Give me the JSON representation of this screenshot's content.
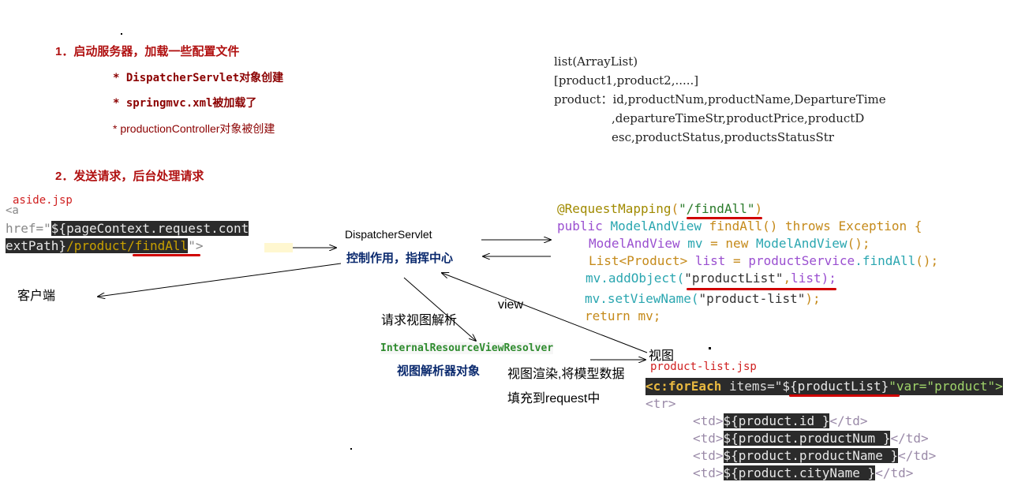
{
  "steps": {
    "step1": "1．启动服务器，加载一些配置文件",
    "step1_items": [
      "* DispatcherServlet对象创建",
      "* springmvc.xml被加载了",
      "* productionController对象被创建"
    ],
    "step2": "2．发送请求，后台处理请求"
  },
  "model_info": {
    "line1": "list(ArrayList)",
    "line2": "[product1,product2,.....]",
    "line3_label": "product：",
    "line3": "id,productNum,productName,DepartureTime",
    "line4": ",departureTimeStr,productPrice,productD",
    "line5": "esc,productStatus,productsStatusStr"
  },
  "aside": {
    "filename": "aside.jsp",
    "l1": "<a",
    "l2_prefix": "href=\"",
    "l2_expr": "${pageContext.request.cont",
    "l3_expr": "extPath}",
    "l3_path": "/product/findAll",
    "l3_tail": "\">"
  },
  "client": "客户端",
  "dispatcher": {
    "name": "DispatcherServlet",
    "role": "控制作用，指挥中心"
  },
  "resolve_label": "请求视图解析",
  "view_label": "view",
  "resolver": {
    "name": "InternalResourceViewResolver",
    "desc": "视图解析器对象"
  },
  "view_target": "视图",
  "render_desc": {
    "l1": "视图渲染,将模型数据",
    "l2": "填充到request中"
  },
  "controller_code": {
    "mapping_ann": "@RequestMapping",
    "mapping_path": "\"/findAll\"",
    "sig_public": "public",
    "sig_type": "ModelAndView",
    "sig_method": "findAll",
    "sig_parens": "()",
    "sig_throws": "throws",
    "sig_exc": "Exception",
    "sig_brace": "{",
    "l2_type": "ModelAndView",
    "l2_var": "mv",
    "l2_eq": "=",
    "l2_new": "new",
    "l2_ctor": "ModelAndView",
    "l2_tail": "();",
    "l3_type": "List<Product>",
    "l3_var": "list",
    "l3_eq": "=",
    "l3_svc": "productService",
    "l3_call": ".findAll",
    "l3_tail": "();",
    "l4_call": "mv.addObject(",
    "l4_key": "\"productList\"",
    "l4_comma": ",",
    "l4_val": "list",
    "l4_tail": ");",
    "l5_call": "mv.setViewName(",
    "l5_val": "\"product-list\"",
    "l5_tail": ");",
    "l6_return": "return",
    "l6_val": "mv;"
  },
  "product_list": {
    "filename": "product-list.jsp",
    "foreach_tag": "<c:forEach",
    "items_attr": "items=\"",
    "items_expr": "${productList}",
    "var_attr": "\"var=\"product\">",
    "tr": "<tr>",
    "td_rows": [
      "${product.id }",
      "${product.productNum }",
      "${product.productName }",
      "${product.cityName }"
    ]
  },
  "colors": {
    "heading_red": "#b01010",
    "underline_red": "#d00000",
    "code_bg": "#2b2b2b",
    "resolver_green": "#2e8b2e",
    "dispatcher_blue": "#0b2a6e"
  }
}
